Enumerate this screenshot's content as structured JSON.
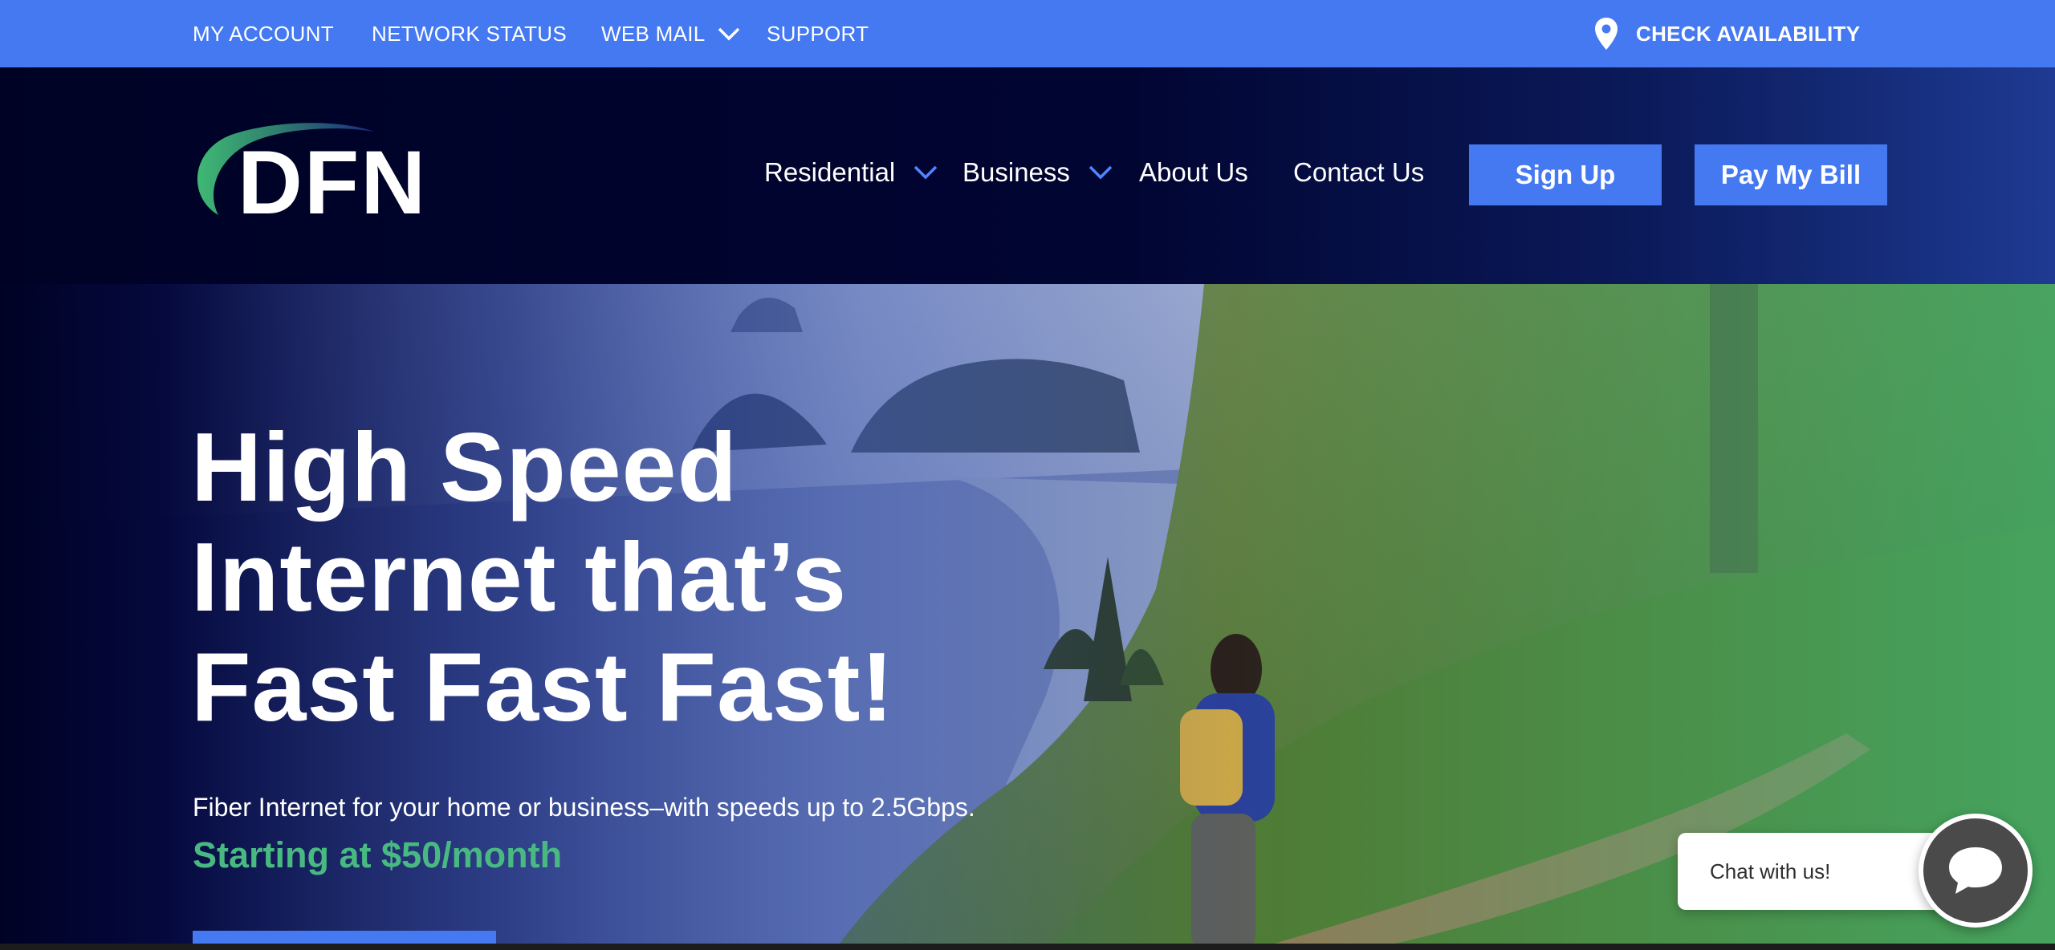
{
  "topbar": {
    "my_account": "MY ACCOUNT",
    "network_status": "NETWORK STATUS",
    "web_mail": "WEB MAIL",
    "support": "SUPPORT",
    "check_availability": "CHECK AVAILABILITY"
  },
  "header": {
    "logo_text": "DFN",
    "nav": {
      "residential": "Residential",
      "business": "Business",
      "about": "About Us",
      "contact": "Contact Us"
    },
    "sign_up": "Sign Up",
    "pay_bill": "Pay My Bill"
  },
  "hero": {
    "headline_line1": "High Speed",
    "headline_line2": "Internet that’s",
    "headline_line3": "Fast Fast Fast!",
    "subtitle": "Fiber Internet for your home or business–with speeds up to 2.5Gbps.",
    "price": "Starting at $50/month"
  },
  "chat": {
    "label": "Chat with us!"
  },
  "colors": {
    "accent_blue": "#4579f2",
    "navy": "#000225",
    "green": "#49b982"
  },
  "icons": {
    "location": "location-pin-icon",
    "dropdown": "chevron-down-icon",
    "chat": "chat-bubble-icon"
  }
}
